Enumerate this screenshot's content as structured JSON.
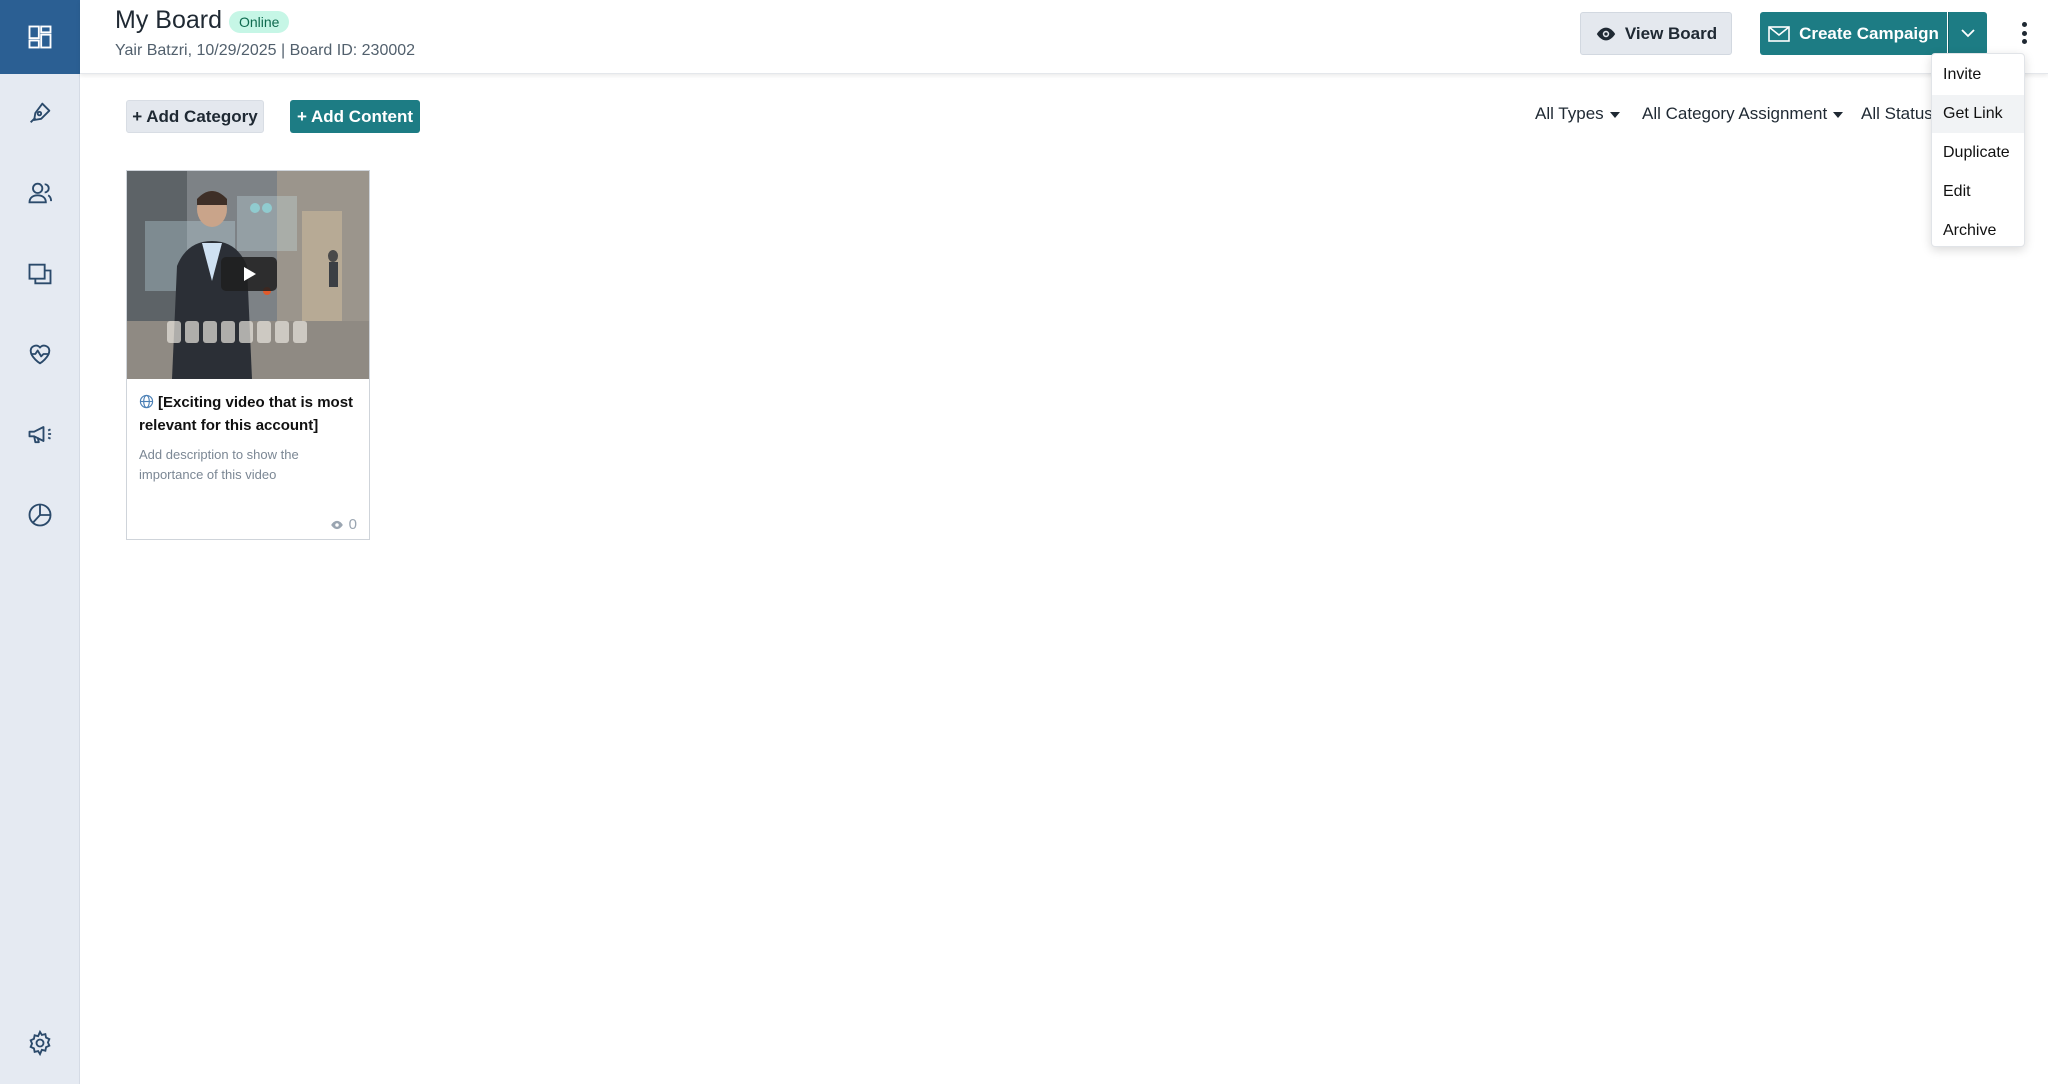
{
  "sidebar": {
    "items": [
      {
        "icon": "dashboard-icon",
        "active": true
      },
      {
        "icon": "pen-tool-icon"
      },
      {
        "icon": "users-icon"
      },
      {
        "icon": "boards-icon"
      },
      {
        "icon": "heart-pulse-icon"
      },
      {
        "icon": "megaphone-icon"
      },
      {
        "icon": "pie-chart-icon"
      }
    ],
    "settings_icon": "gear-icon"
  },
  "header": {
    "title": "My Board",
    "status_badge": "Online",
    "subtitle": "Yair Batzri, 10/29/2025 | Board ID: 230002",
    "view_board_label": "View Board",
    "create_campaign_label": "Create Campaign"
  },
  "toolbar": {
    "add_category_label": "+ Add Category",
    "add_content_label": "+ Add Content",
    "filters": [
      "All Types",
      "All Category Assignment",
      "All Status"
    ]
  },
  "cards": [
    {
      "title": "[Exciting video that is most relevant for this account]",
      "description": "Add description to show the importance of this video",
      "views": "0"
    }
  ],
  "menu": {
    "items": [
      "Invite",
      "Get Link",
      "Duplicate",
      "Edit",
      "Archive"
    ],
    "hovered": "Get Link"
  },
  "colors": {
    "accent": "#1d7c84",
    "sidebar_active": "#2b5f93",
    "sidebar_bg": "#e5eaf2",
    "badge_bg": "#c6f6e6"
  }
}
